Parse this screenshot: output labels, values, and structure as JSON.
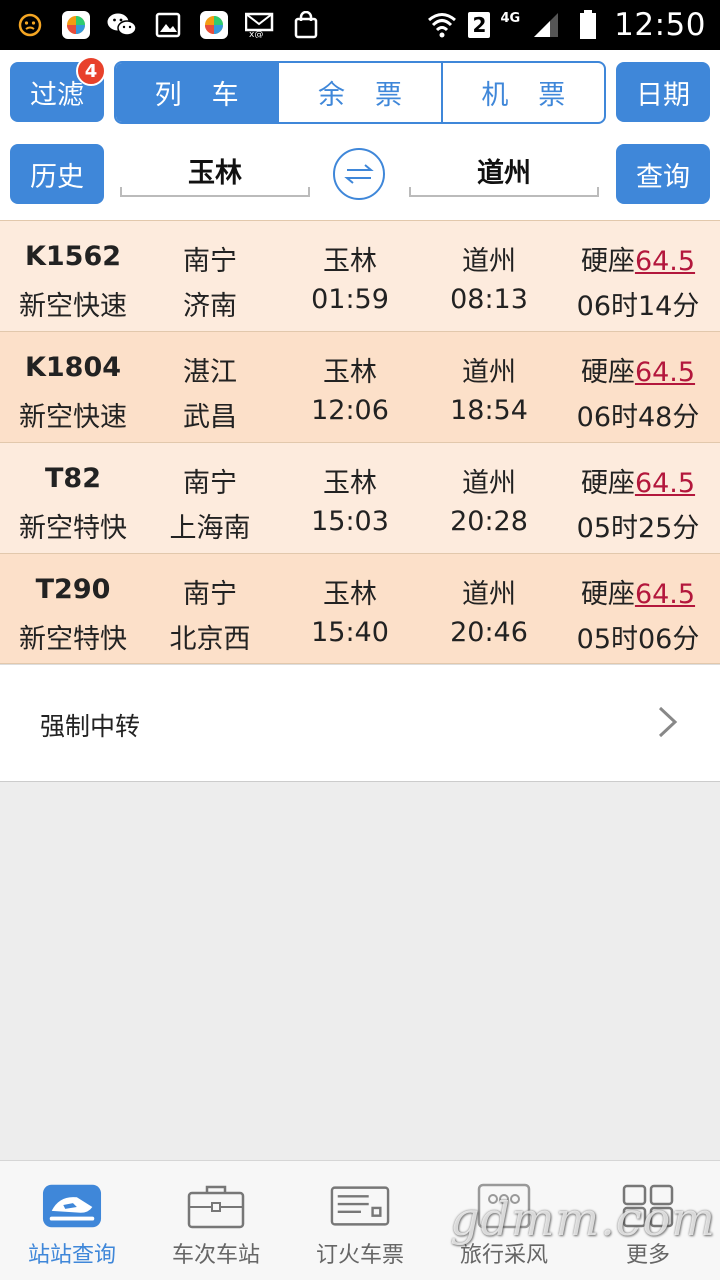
{
  "statusbar": {
    "time": "12:50",
    "sim": "2",
    "network": "4G"
  },
  "toolbar": {
    "filter_label": "过滤",
    "filter_badge": "4",
    "tabs": [
      {
        "label": "列车",
        "active": true
      },
      {
        "label": "余票",
        "active": false
      },
      {
        "label": "机票",
        "active": false
      }
    ],
    "date_label": "日期",
    "history_label": "历史",
    "from_station": "玉林",
    "to_station": "道州",
    "search_label": "查询"
  },
  "results": [
    {
      "train": "K1562",
      "type": "新空快速",
      "origin": "南宁",
      "terminal": "济南",
      "from": "玉林",
      "depart": "01:59",
      "to": "道州",
      "arrive": "08:13",
      "seat": "硬座",
      "price": "64.5",
      "duration": "06时14分"
    },
    {
      "train": "K1804",
      "type": "新空快速",
      "origin": "湛江",
      "terminal": "武昌",
      "from": "玉林",
      "depart": "12:06",
      "to": "道州",
      "arrive": "18:54",
      "seat": "硬座",
      "price": "64.5",
      "duration": "06时48分"
    },
    {
      "train": "T82",
      "type": "新空特快",
      "origin": "南宁",
      "terminal": "上海南",
      "from": "玉林",
      "depart": "15:03",
      "to": "道州",
      "arrive": "20:28",
      "seat": "硬座",
      "price": "64.5",
      "duration": "05时25分"
    },
    {
      "train": "T290",
      "type": "新空特快",
      "origin": "南宁",
      "terminal": "北京西",
      "from": "玉林",
      "depart": "15:40",
      "to": "道州",
      "arrive": "20:46",
      "seat": "硬座",
      "price": "64.5",
      "duration": "05时06分"
    }
  ],
  "transfer": {
    "label": "强制中转"
  },
  "bottomnav": {
    "items": [
      {
        "label": "站站查询",
        "icon": "train-icon",
        "active": true
      },
      {
        "label": "车次车站",
        "icon": "briefcase-icon",
        "active": false
      },
      {
        "label": "订火车票",
        "icon": "ticket-icon",
        "active": false
      },
      {
        "label": "旅行采风",
        "icon": "camera-icon",
        "active": false
      },
      {
        "label": "更多",
        "icon": "grid-icon",
        "active": false
      }
    ]
  },
  "watermark": "gdmm.com",
  "colors": {
    "accent": "#3f87d9",
    "badge": "#e8412b",
    "price": "#b3173c",
    "row_odd": "#fdebdd",
    "row_even": "#fce0c9"
  }
}
